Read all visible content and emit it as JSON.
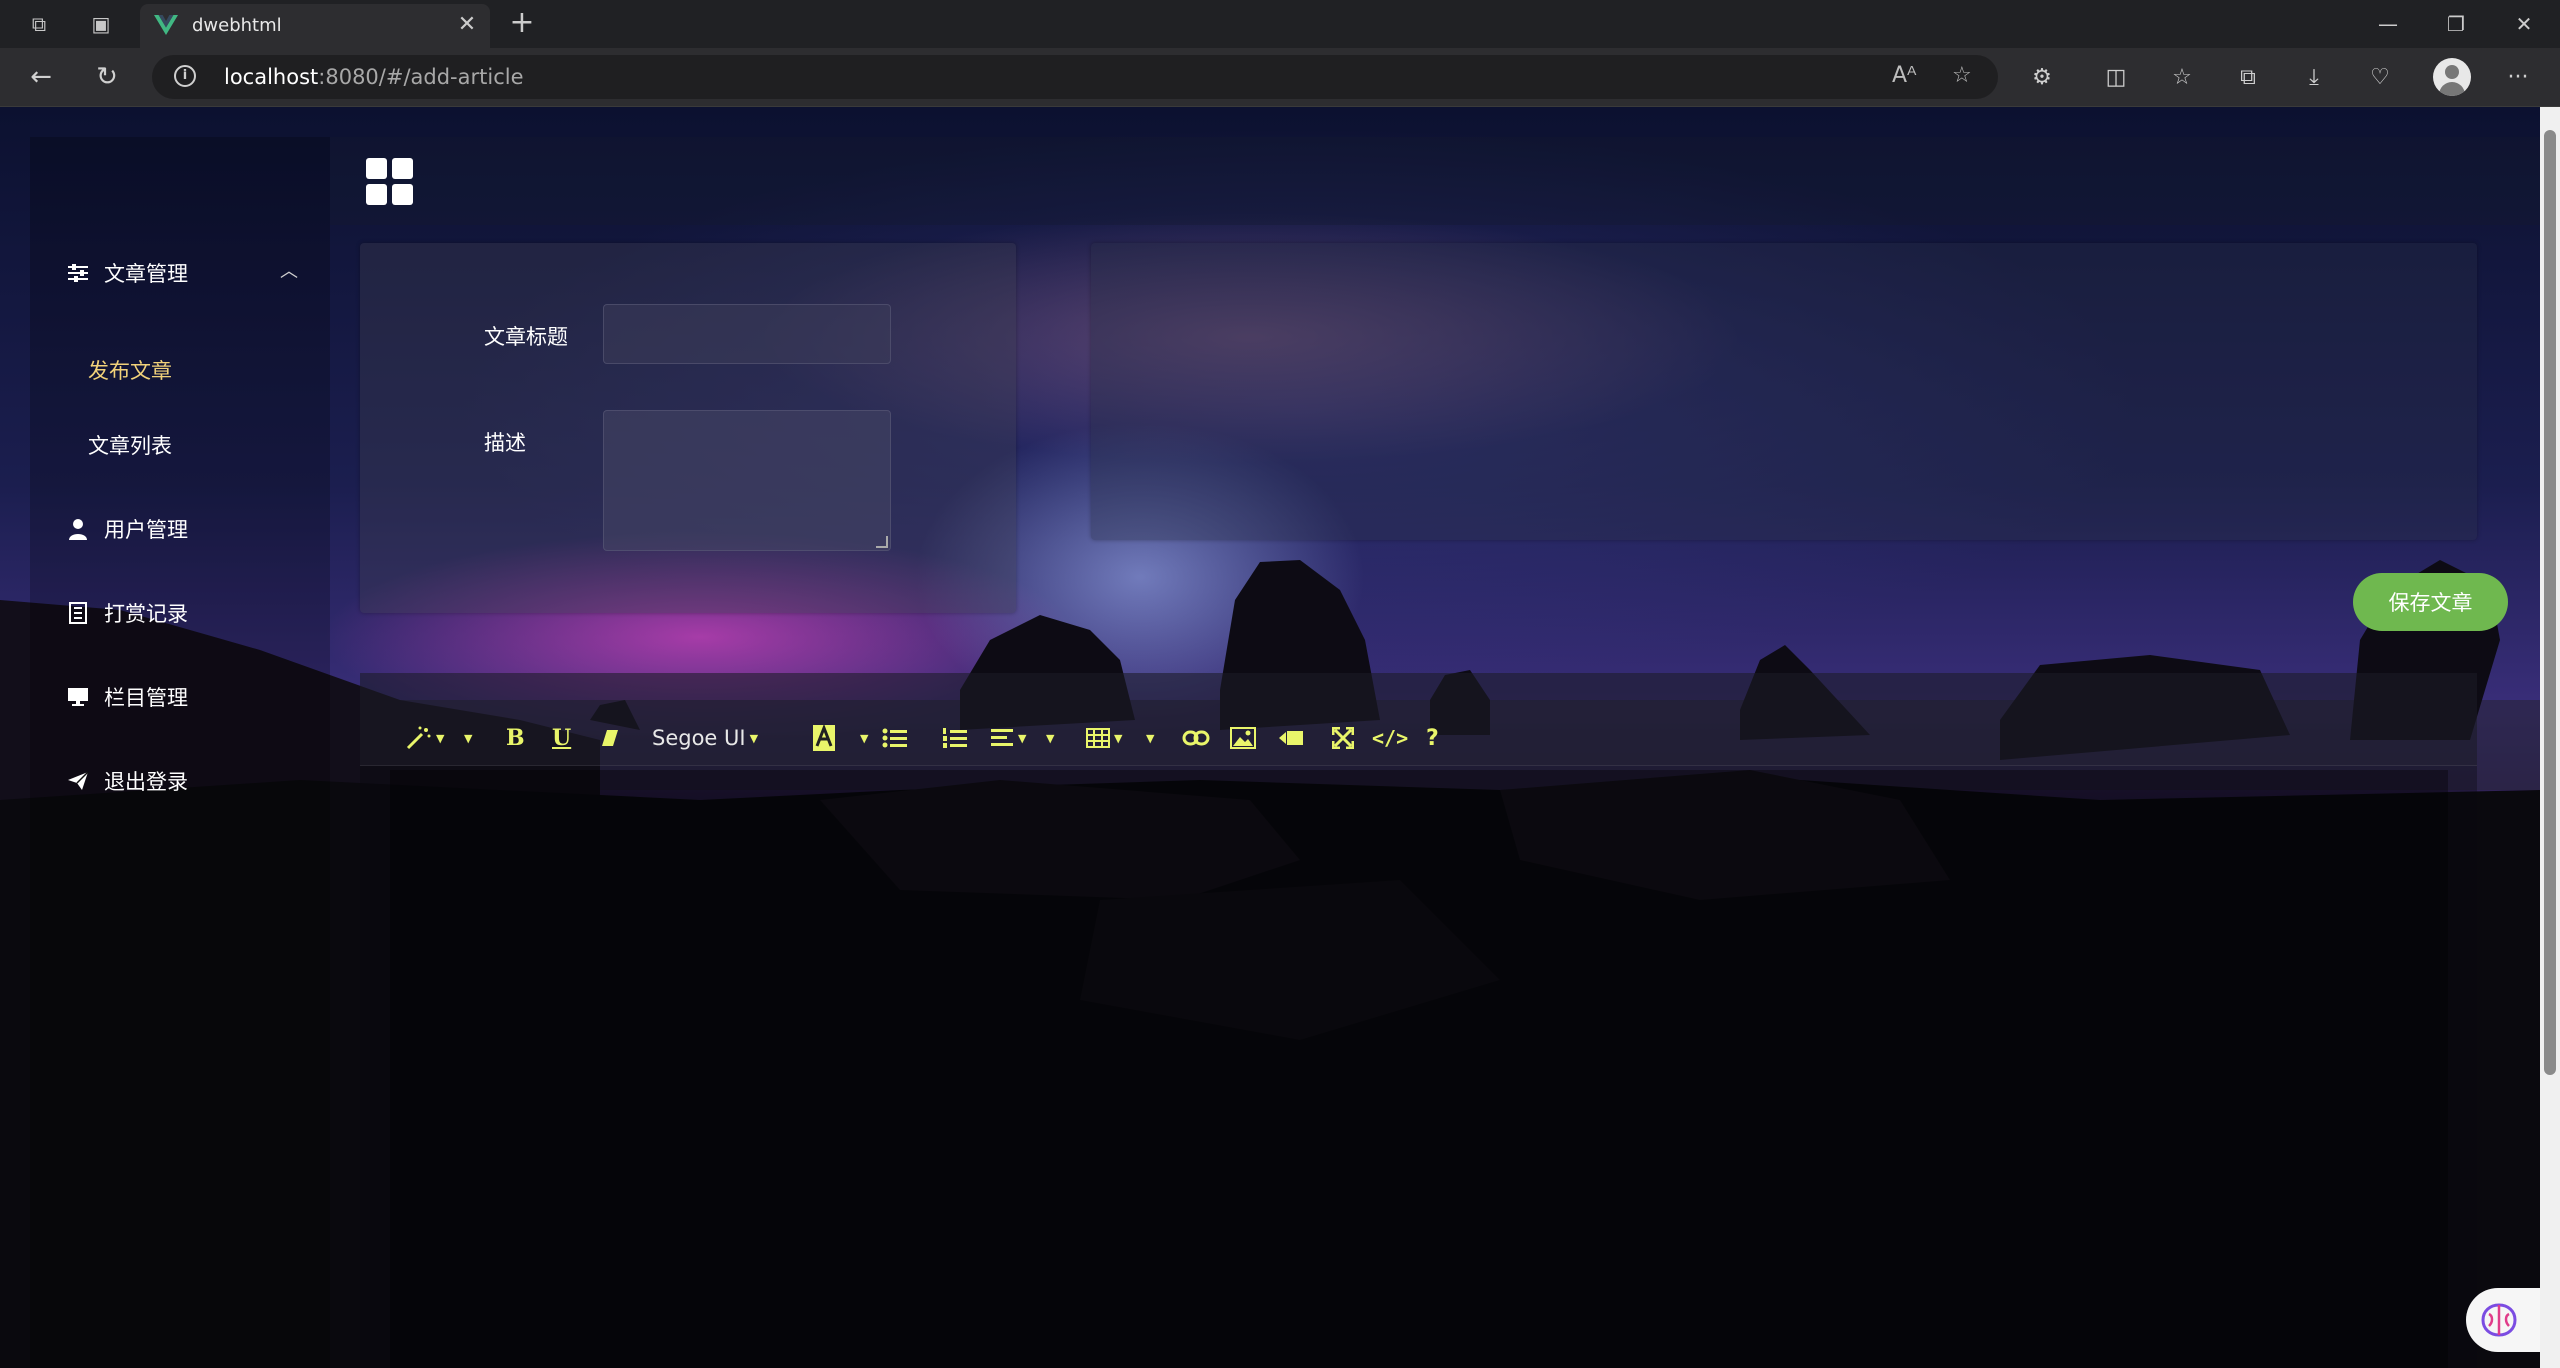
{
  "browser": {
    "tab_title": "dwebhtml",
    "url_host": "localhost",
    "url_rest": ":8080/#/add-article",
    "new_tab": "+",
    "close": "✕"
  },
  "sidebar": {
    "group_label": "文章管理",
    "sub_items": [
      {
        "label": "发布文章",
        "active": true
      },
      {
        "label": "文章列表",
        "active": false
      }
    ],
    "items": [
      {
        "label": "用户管理",
        "icon": "user-icon"
      },
      {
        "label": "打赏记录",
        "icon": "receipt-icon"
      },
      {
        "label": "栏目管理",
        "icon": "monitor-icon"
      },
      {
        "label": "退出登录",
        "icon": "send-icon"
      }
    ]
  },
  "form": {
    "title_label": "文章标题",
    "title_value": "",
    "desc_label": "描述",
    "desc_value": ""
  },
  "actions": {
    "save_label": "保存文章"
  },
  "editor": {
    "font_name": "Segoe UI",
    "tools": [
      "magic-icon",
      "bold-icon",
      "underline-icon",
      "eraser-icon",
      "font-family-select",
      "text-color-icon",
      "bullet-list-icon",
      "numbered-list-icon",
      "align-icon",
      "table-icon",
      "link-icon",
      "image-icon",
      "video-icon",
      "fullscreen-icon",
      "code-view-icon",
      "help-icon"
    ],
    "bold": "B",
    "underline": "U",
    "code": "</>",
    "help": "?"
  },
  "colors": {
    "accent_green": "#6fb84f",
    "toolbar_icon": "#e9f56a",
    "active_menu": "#f2d27a"
  }
}
